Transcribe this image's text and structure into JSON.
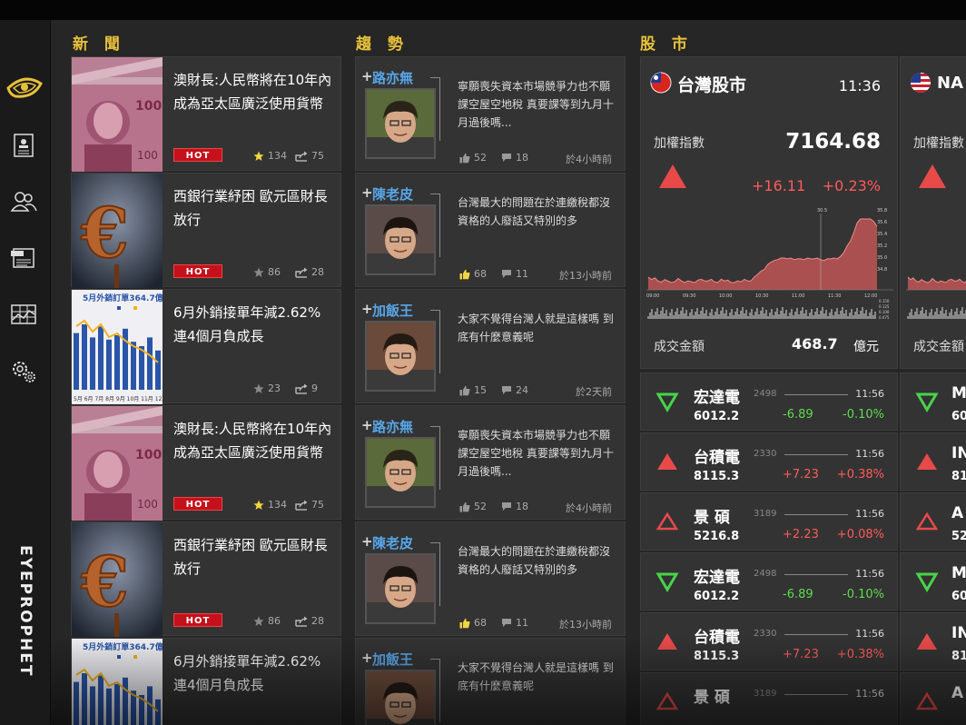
{
  "brand": "EYEPROPHET",
  "headings": {
    "news": "新 聞",
    "trend": "趨 勢",
    "stock": "股 市"
  },
  "nav": [
    "eye-logo-icon",
    "profile-icon",
    "people-icon",
    "newspaper-icon",
    "chart-grid-icon",
    "settings-icon"
  ],
  "news": [
    {
      "title": "澳財長:人民幣將在10年內成為亞太區廣泛使用貨幣",
      "hot": "HOT",
      "stars": "134",
      "shares": "75",
      "hot_shown": true,
      "star_active": true,
      "thumb": "yuan-banknote"
    },
    {
      "title": "西銀行業紓困 歐元區財長放行",
      "hot": "HOT",
      "stars": "86",
      "shares": "28",
      "hot_shown": true,
      "star_active": false,
      "thumb": "euro-symbol"
    },
    {
      "title": "6月外銷接單年減2.62% 連4個月負成長",
      "hot": "",
      "stars": "23",
      "shares": "9",
      "hot_shown": false,
      "star_active": false,
      "thumb": "export-chart"
    },
    {
      "title": "澳財長:人民幣將在10年內成為亞太區廣泛使用貨幣",
      "hot": "HOT",
      "stars": "134",
      "shares": "75",
      "hot_shown": true,
      "star_active": true,
      "thumb": "yuan-banknote"
    },
    {
      "title": "西銀行業紓困 歐元區財長放行",
      "hot": "HOT",
      "stars": "86",
      "shares": "28",
      "hot_shown": true,
      "star_active": false,
      "thumb": "euro-symbol"
    },
    {
      "title": "6月外銷接單年減2.62% 連4個月負成長",
      "hot": "",
      "stars": "",
      "shares": "",
      "hot_shown": false,
      "star_active": false,
      "thumb": "export-chart"
    }
  ],
  "chart_thumb_text": "5月外銷訂單364.7億",
  "trends": [
    {
      "name": "路亦無",
      "plus": "+",
      "text": "寧願喪失資本市場競爭力也不願課空屋空地稅 真要課等到九月十月過後嗎...",
      "likes": "52",
      "comments": "18",
      "time": "於4小時前",
      "like_active": false
    },
    {
      "name": "陳老皮",
      "plus": "+",
      "text": "台灣最大的問題在於連繳稅都沒資格的人廢話又特別的多",
      "likes": "68",
      "comments": "11",
      "time": "於13小時前",
      "like_active": true
    },
    {
      "name": "加飯王",
      "plus": "+",
      "text": "大家不覺得台灣人就是這樣嗎 到底有什麼意義呢",
      "likes": "15",
      "comments": "24",
      "time": "於2天前",
      "like_active": false
    },
    {
      "name": "路亦無",
      "plus": "+",
      "text": "寧願喪失資本市場競爭力也不願課空屋空地稅 真要課等到九月十月過後嗎...",
      "likes": "52",
      "comments": "18",
      "time": "於4小時前",
      "like_active": false
    },
    {
      "name": "陳老皮",
      "plus": "+",
      "text": "台灣最大的問題在於連繳稅都沒資格的人廢話又特別的多",
      "likes": "68",
      "comments": "11",
      "time": "於13小時前",
      "like_active": true
    },
    {
      "name": "加飯王",
      "plus": "+",
      "text": "大家不覺得台灣人就是這樣嗎 到底有什麼意義呢",
      "likes": "",
      "comments": "",
      "time": "",
      "like_active": false
    }
  ],
  "market": {
    "name": "台灣股市",
    "time": "11:36",
    "index_label": "加權指數",
    "index_value": "7164.68",
    "change": "+16.11",
    "change_pct": "+0.23%",
    "volume_label": "成交金額",
    "volume_value": "468.7",
    "volume_unit": "億元",
    "chart_marker": "30.5",
    "chart_yticks": [
      "35.8",
      "35.6",
      "35.4",
      "35.2",
      "35.0",
      "34.8"
    ],
    "chart_xticks": [
      "09:00",
      "09:30",
      "10:00",
      "10:30",
      "11:00",
      "11:30",
      "12:00"
    ],
    "chart_vticks": [
      "0.150",
      "0.125",
      "0.100",
      "0.075"
    ],
    "colors": {
      "up": "#e84a4a",
      "down": "#49d34a"
    }
  },
  "market2": {
    "name": "NA",
    "index_label": "加權指數",
    "volume_label": "成交金額"
  },
  "stocks": [
    {
      "name": "宏達電",
      "code": "2498",
      "time": "11:56",
      "price": "6012.2",
      "change": "-6.89",
      "pct": "-0.10%",
      "dir": "down"
    },
    {
      "name": "台積電",
      "code": "2330",
      "time": "11:56",
      "price": "8115.3",
      "change": "+7.23",
      "pct": "+0.38%",
      "dir": "up"
    },
    {
      "name": "景  碩",
      "code": "3189",
      "time": "11:56",
      "price": "5216.8",
      "change": "+2.23",
      "pct": "+0.08%",
      "dir": "up-outline"
    },
    {
      "name": "宏達電",
      "code": "2498",
      "time": "11:56",
      "price": "6012.2",
      "change": "-6.89",
      "pct": "-0.10%",
      "dir": "down"
    },
    {
      "name": "台積電",
      "code": "2330",
      "time": "11:56",
      "price": "8115.3",
      "change": "+7.23",
      "pct": "+0.38%",
      "dir": "up"
    },
    {
      "name": "景  碩",
      "code": "3189",
      "time": "11:56",
      "price": "",
      "change": "",
      "pct": "",
      "dir": "up-outline"
    }
  ],
  "stocks2": [
    {
      "letter": "M",
      "price": "60",
      "dir": "down"
    },
    {
      "letter": "IN",
      "price": "81",
      "dir": "up"
    },
    {
      "letter": "A",
      "price": "52",
      "dir": "up-outline"
    },
    {
      "letter": "M",
      "price": "60",
      "dir": "down"
    },
    {
      "letter": "IN",
      "price": "81",
      "dir": "up"
    },
    {
      "letter": "A",
      "price": "",
      "dir": "up-outline"
    }
  ]
}
